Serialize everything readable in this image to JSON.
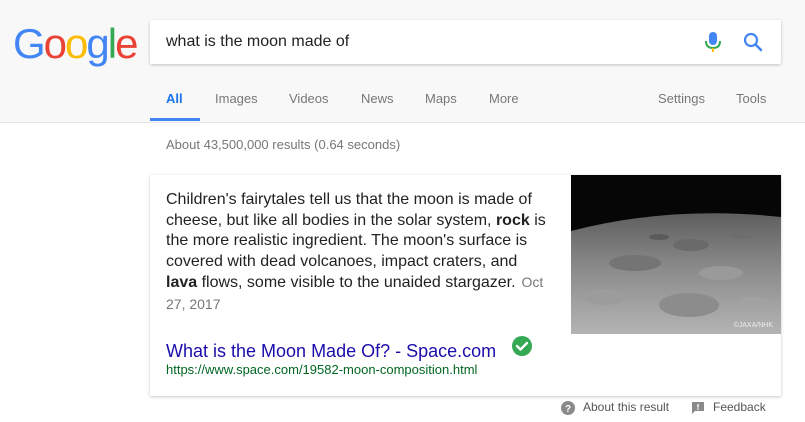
{
  "logo": {
    "letters": [
      {
        "ch": "G",
        "color": "#4285F4"
      },
      {
        "ch": "o",
        "color": "#EA4335"
      },
      {
        "ch": "o",
        "color": "#FBBC05"
      },
      {
        "ch": "g",
        "color": "#4285F4"
      },
      {
        "ch": "l",
        "color": "#34A853"
      },
      {
        "ch": "e",
        "color": "#EA4335"
      }
    ]
  },
  "search": {
    "query": "what is the moon made of"
  },
  "tabs": {
    "all": "All",
    "images": "Images",
    "videos": "Videos",
    "news": "News",
    "maps": "Maps",
    "more": "More",
    "settings": "Settings",
    "tools": "Tools"
  },
  "stats": "About 43,500,000 results (0.64 seconds)",
  "featured": {
    "snippet_1": "Children's fairytales tell us that the moon is made of cheese, but like all bodies in the solar system, ",
    "snippet_bold_1": "rock",
    "snippet_2": " is the more realistic ingredient. The moon's surface is covered with dead volcanoes, impact craters, and ",
    "snippet_bold_2": "lava",
    "snippet_3": " flows, some visible to the unaided stargazer.",
    "date": "Oct 27, 2017",
    "image_credit": "©JAXA/NHK",
    "title": "What is the Moon Made Of? - Space.com",
    "url": "https://www.space.com/19582-moon-composition.html"
  },
  "footer": {
    "about": "About this result",
    "feedback": "Feedback"
  },
  "colors": {
    "accent": "#4285f4",
    "link": "#1a0dab",
    "url": "#006621",
    "verified": "#34A853"
  }
}
